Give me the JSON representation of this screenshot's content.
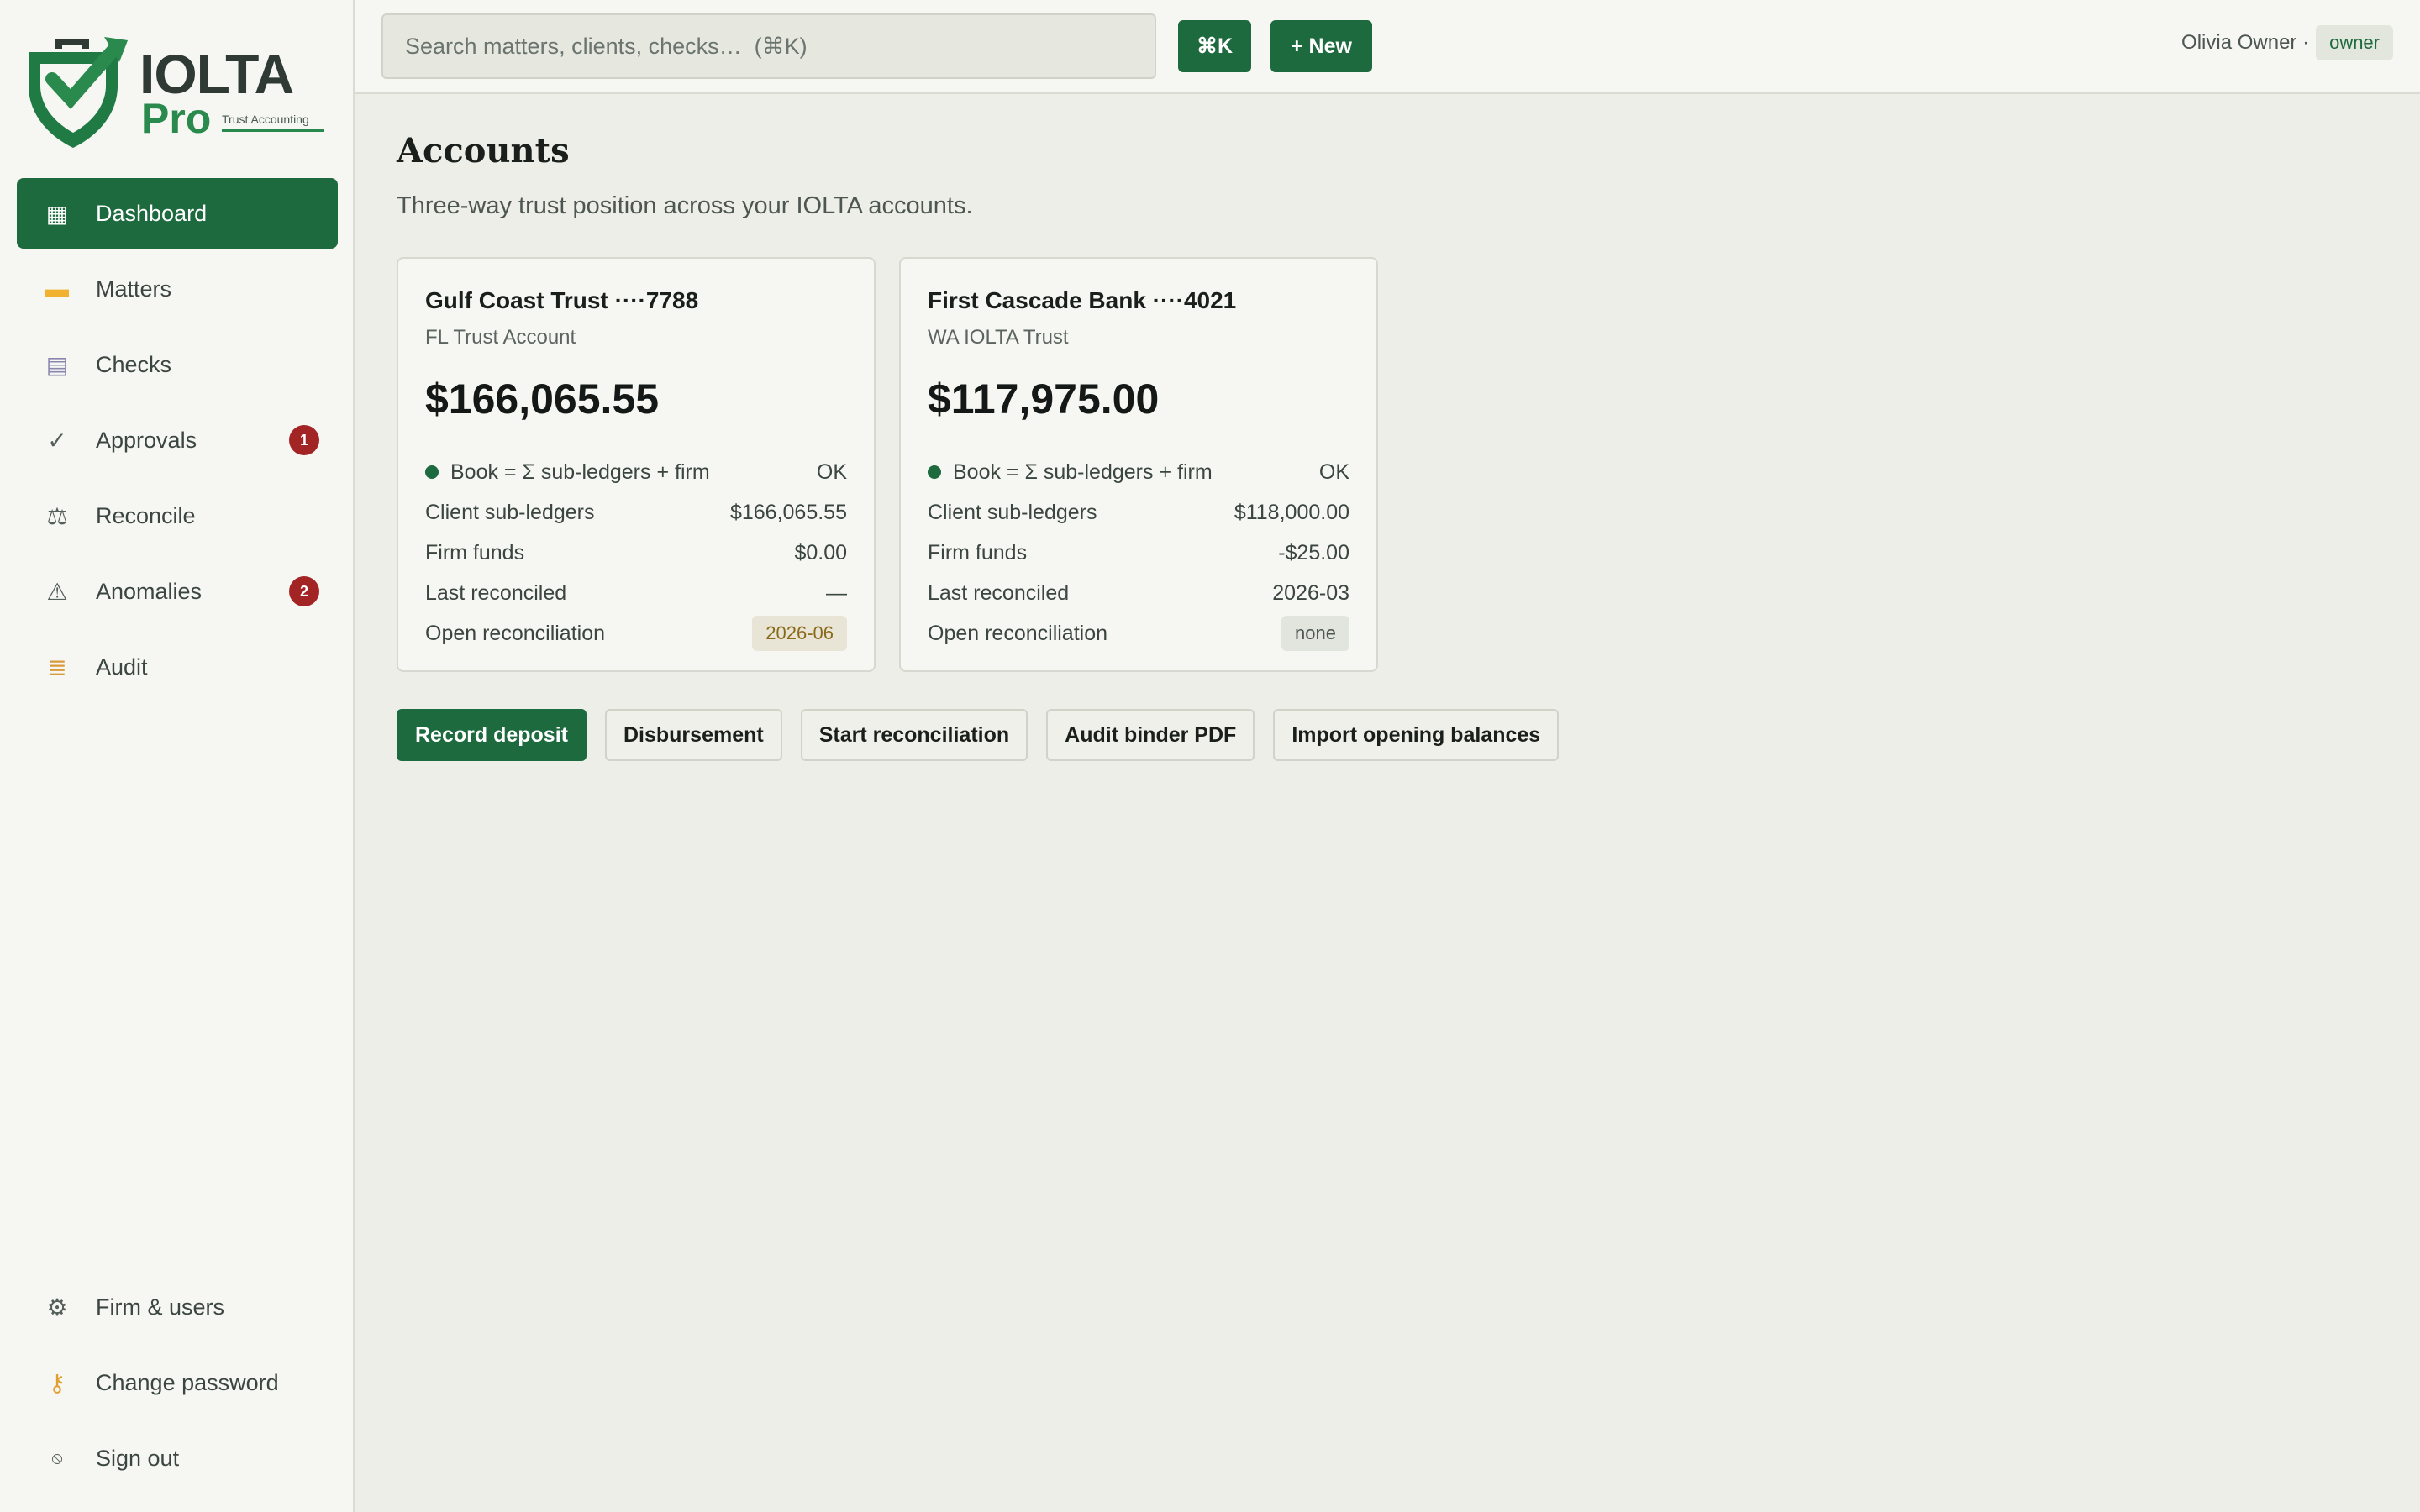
{
  "brand": {
    "title": "IOLTA",
    "pro": "Pro",
    "tagline": "Trust Accounting"
  },
  "sidebar": {
    "items": [
      {
        "label": "Dashboard",
        "icon": "grid-icon",
        "active": true
      },
      {
        "label": "Matters",
        "icon": "folder-icon"
      },
      {
        "label": "Checks",
        "icon": "receipt-icon"
      },
      {
        "label": "Approvals",
        "icon": "checkmark-icon",
        "badge": "1"
      },
      {
        "label": "Reconcile",
        "icon": "scales-icon"
      },
      {
        "label": "Anomalies",
        "icon": "warning-icon",
        "badge": "2"
      },
      {
        "label": "Audit",
        "icon": "scroll-icon"
      }
    ],
    "bottom": [
      {
        "label": "Firm & users",
        "icon": "gear-icon"
      },
      {
        "label": "Change password",
        "icon": "key-icon"
      },
      {
        "label": "Sign out",
        "icon": "signout-icon"
      }
    ]
  },
  "topbar": {
    "search_placeholder": "Search matters, clients, checks…  (⌘K)",
    "cmd_label": "⌘K",
    "new_label": "+ New",
    "user_name": "Olivia Owner ·",
    "user_role": "owner"
  },
  "page": {
    "title": "Accounts",
    "subtitle": "Three-way trust position across your IOLTA accounts."
  },
  "accounts": [
    {
      "name": "Gulf Coast Trust ····7788",
      "type": "FL Trust Account",
      "balance": "$166,065.55",
      "check_label": "Book = Σ sub-ledgers + firm",
      "check_status": "OK",
      "client_label": "Client sub-ledgers",
      "client_value": "$166,065.55",
      "firm_label": "Firm funds",
      "firm_value": "$0.00",
      "last_label": "Last reconciled",
      "last_value": "—",
      "open_label": "Open reconciliation",
      "open_value": "2026-06"
    },
    {
      "name": "First Cascade Bank ····4021",
      "type": "WA IOLTA Trust",
      "balance": "$117,975.00",
      "check_label": "Book = Σ sub-ledgers + firm",
      "check_status": "OK",
      "client_label": "Client sub-ledgers",
      "client_value": "$118,000.00",
      "firm_label": "Firm funds",
      "firm_value": "-$25.00",
      "last_label": "Last reconciled",
      "last_value": "2026-03",
      "open_label": "Open reconciliation",
      "open_value": "none"
    }
  ],
  "actions": {
    "record_deposit": "Record deposit",
    "disbursement": "Disbursement",
    "start_reconciliation": "Start reconciliation",
    "audit_binder": "Audit binder PDF",
    "import_opening": "Import opening balances"
  },
  "colors": {
    "accent": "#1c6a3e",
    "badge": "#a32424",
    "pending": "#8a6a1a"
  }
}
